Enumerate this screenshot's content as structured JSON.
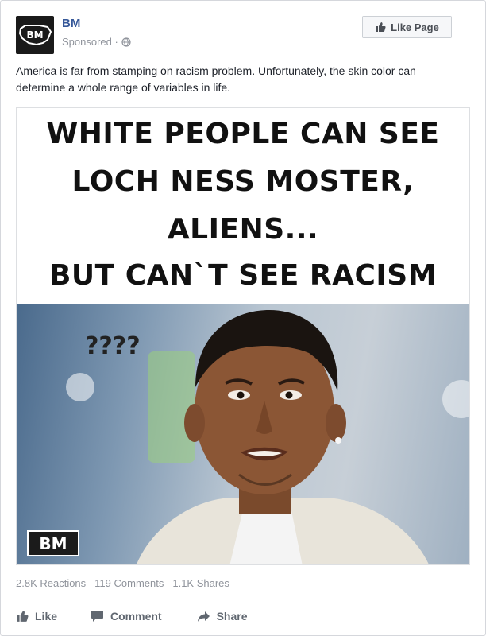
{
  "post": {
    "page_name": "BM",
    "sponsored_label": "Sponsored ·",
    "like_page_label": "Like Page",
    "text": "America is far from stamping on racism problem. Unfortunately, the skin color can determine a whole range of variables in life."
  },
  "image": {
    "caption_lines": [
      "WHITE PEOPLE CAN SEE",
      "LOCH NESS MOSTER,",
      "ALIENS...",
      "BUT CAN`T SEE RACISM"
    ],
    "question_marks": "????",
    "badge": "BM"
  },
  "stats": {
    "reactions": "2.8K Reactions",
    "comments": "119 Comments",
    "shares": "1.1K Shares"
  },
  "actions": {
    "like": "Like",
    "comment": "Comment",
    "share": "Share"
  },
  "colors": {
    "link_blue": "#365899",
    "meta_gray": "#90949c",
    "action_gray": "#606770"
  },
  "icons": {
    "avatar": "bm-map-logo",
    "privacy": "globe-icon",
    "like": "thumbs-up-icon",
    "comment": "speech-bubble-icon",
    "share": "share-arrow-icon"
  }
}
